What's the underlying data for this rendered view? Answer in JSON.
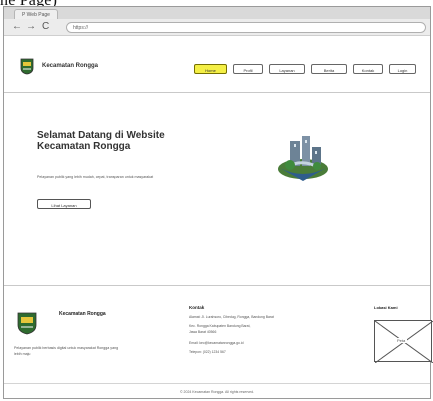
{
  "caption": "ne Page)",
  "browser": {
    "tab_label": "P Web Page",
    "back_glyph": "←",
    "forward_glyph": "→",
    "reload_glyph": "C",
    "url": "https://"
  },
  "header": {
    "brand": "Kecamatan Rongga",
    "menu": [
      {
        "label": "Home",
        "active": true
      },
      {
        "label": "Profil",
        "active": false
      },
      {
        "label": "Layanan",
        "active": false
      },
      {
        "label": "Berita",
        "active": false
      },
      {
        "label": "Kontak",
        "active": false
      },
      {
        "label": "Login",
        "active": false
      }
    ]
  },
  "hero": {
    "title": "Selamat Datang di Website Kecamatan Rongga",
    "subtitle": "Pelayanan publik yang lebih mudah, cepat, transparan untuk masyarakat",
    "cta": "Lihat Layanan"
  },
  "footer": {
    "brand": "Kecamatan Rongga",
    "description": "Pelayanan publik berbasis digital untuk masyarakat Rongga yang lebih maju",
    "contact_title": "Kontak",
    "contact_lines": [
      "Alamat: Jl. Lurahsoro, Cibedug, Rongga, Bandung Barat",
      "Kec. Rongga Kabupaten Bandung Barat,",
      "Jawa Barat 40566",
      "Email: kec@kecamatanrongga.go.id",
      "Telepon: (022) 1234 567"
    ],
    "map_title": "Lokasi Kami",
    "map_label": "Peta",
    "copyright": "© 2024 Kecamatan Rongga. All rights reserved."
  },
  "colors": {
    "active_menu": "#f4ef45",
    "text": "#333333"
  }
}
